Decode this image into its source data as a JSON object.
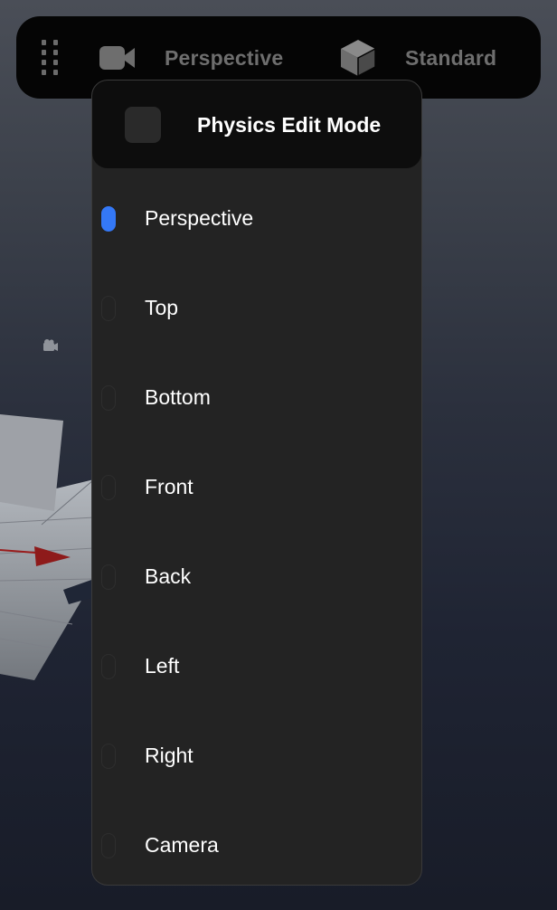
{
  "toolbar": {
    "drag_handle_icon": "drag-grip-icon",
    "view_icon": "video-camera-icon",
    "view_label": "Perspective",
    "shading_icon": "cube-icon",
    "shading_label": "Standard"
  },
  "dropdown": {
    "header": {
      "checkbox_checked": false,
      "label": "Physics Edit Mode"
    },
    "selected": "Perspective",
    "options": [
      {
        "label": "Perspective",
        "active": true
      },
      {
        "label": "Top",
        "active": false
      },
      {
        "label": "Bottom",
        "active": false
      },
      {
        "label": "Front",
        "active": false
      },
      {
        "label": "Back",
        "active": false
      },
      {
        "label": "Left",
        "active": false
      },
      {
        "label": "Right",
        "active": false
      },
      {
        "label": "Camera",
        "active": false
      }
    ]
  },
  "colors": {
    "accent": "#3478f6",
    "panel": "#232323",
    "toolbar": "#050505",
    "axis_x": "#9a1c1c"
  },
  "scene": {
    "gizmo_icon": "camera-gizmo-icon"
  }
}
